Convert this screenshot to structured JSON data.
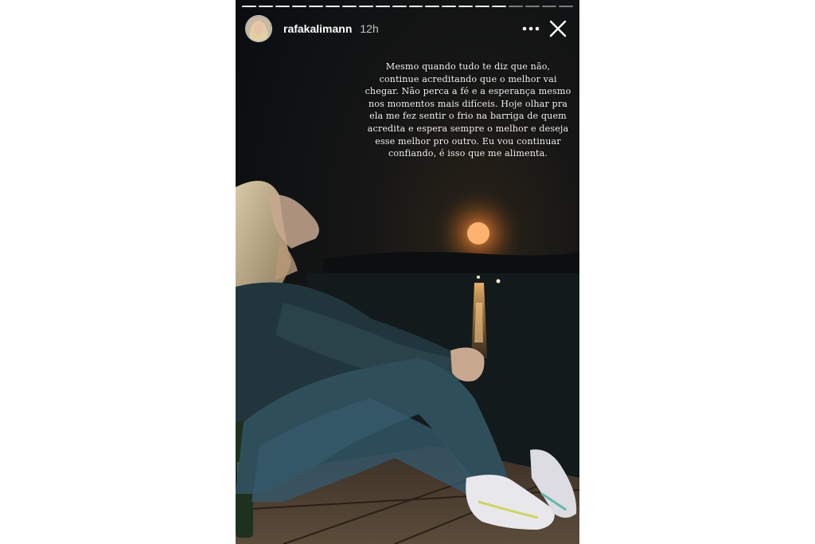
{
  "story": {
    "username": "rafakalimann",
    "time_ago": "12h",
    "progress": {
      "total": 20,
      "current": 16
    },
    "caption_lines": [
      "Mesmo quando tudo te diz que não,",
      "continue acreditando que o melhor vai",
      "chegar. Não perca a fé e a esperança mesmo",
      "nos momentos mais difíceis. Hoje olhar pra",
      "ela me fez sentir o frio na barriga de quem",
      "acredita e espera sempre o melhor e deseja",
      "esse melhor pro outro. Eu vou continuar",
      "confiando, é isso que me alimenta."
    ]
  },
  "icons": {
    "more": "more-horizontal-icon",
    "close": "close-icon"
  },
  "colors": {
    "moon": "#ff9d4a",
    "sky": "#0d1214",
    "water": "#121a1c",
    "outfit": "#2c4a54"
  }
}
